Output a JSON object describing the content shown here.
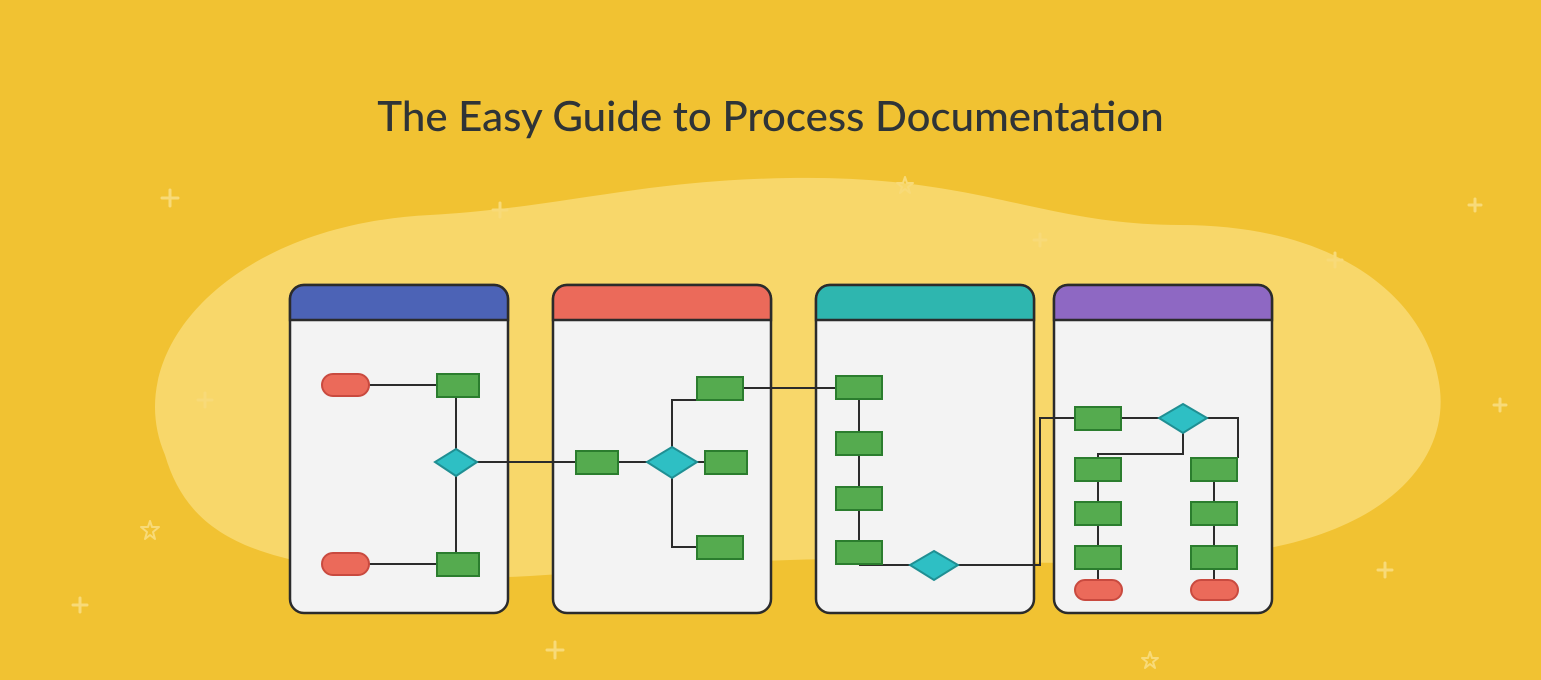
{
  "title": "The Easy Guide to Process Documentation",
  "colors": {
    "background": "#F1C232",
    "cloud": "#F8D76A",
    "panel_fill": "#F3F3F3",
    "panel_stroke": "#2B2B2B",
    "panel_headers": [
      "#4C63B6",
      "#EB6A5A",
      "#2EB6AF",
      "#8E68C3"
    ],
    "shape_process_fill": "#55AB4F",
    "shape_process_stroke": "#2B7D2E",
    "shape_terminal_fill": "#EB6A5A",
    "shape_terminal_stroke": "#C94A3F",
    "shape_decision_fill": "#2EBFC4",
    "shape_decision_stroke": "#1F8F93",
    "connector": "#2B2B2B",
    "decor": "#F8DA78"
  },
  "panels": [
    {
      "header_color_index": 0,
      "shapes": [
        "terminal",
        "process",
        "decision",
        "terminal",
        "process"
      ]
    },
    {
      "header_color_index": 1,
      "shapes": [
        "process",
        "process",
        "decision",
        "process"
      ]
    },
    {
      "header_color_index": 2,
      "shapes": [
        "process",
        "process",
        "process",
        "process",
        "process",
        "decision"
      ]
    },
    {
      "header_color_index": 3,
      "shapes": [
        "process",
        "decision",
        "process",
        "process",
        "process",
        "process",
        "process",
        "process",
        "terminal",
        "terminal"
      ]
    }
  ]
}
